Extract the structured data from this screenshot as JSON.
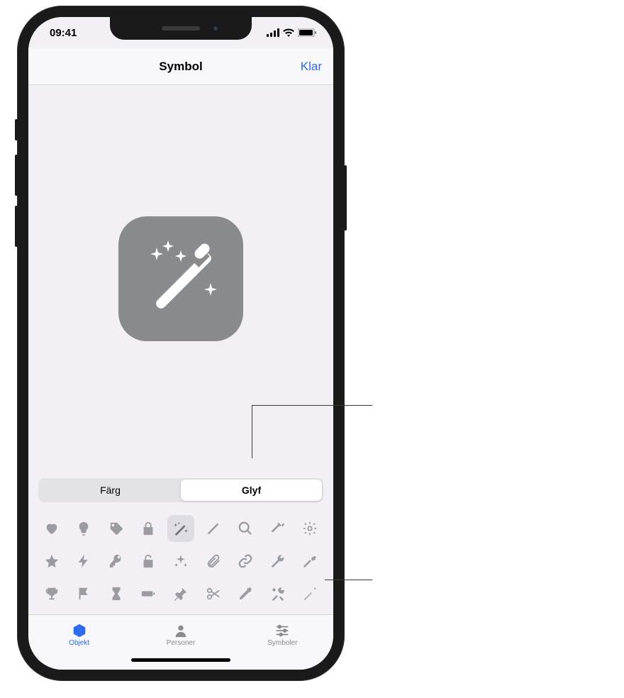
{
  "status": {
    "time": "09:41"
  },
  "nav": {
    "title": "Symbol",
    "done": "Klar"
  },
  "segmented": {
    "color": "Färg",
    "glyph": "Glyf"
  },
  "tabs": {
    "objects": "Objekt",
    "people": "Personer",
    "symbols": "Symboler"
  },
  "preview_icon": "magic-wand-icon",
  "glyph_grid": [
    [
      "heart-icon",
      "lightbulb-icon",
      "tag-icon",
      "lock-icon",
      "magic-wand-icon",
      "pencil-icon",
      "magnifying-glass-icon",
      "hammer-icon",
      "gear-icon"
    ],
    [
      "star-icon",
      "bolt-icon",
      "key-icon",
      "unlock-icon",
      "sparkle-icon",
      "paperclip-icon",
      "link-icon",
      "wrench-icon",
      "hammer-claw-icon"
    ],
    [
      "trophy-icon",
      "flag-icon",
      "hourglass-icon",
      "battery-icon",
      "pushpin-icon",
      "scissors-icon",
      "eyedropper-icon",
      "tools-icon",
      "screwdriver-icon"
    ]
  ],
  "selected_glyph": "magic-wand-icon",
  "colors": {
    "accent": "#2f6bed",
    "icon_bg": "#888a8c"
  }
}
